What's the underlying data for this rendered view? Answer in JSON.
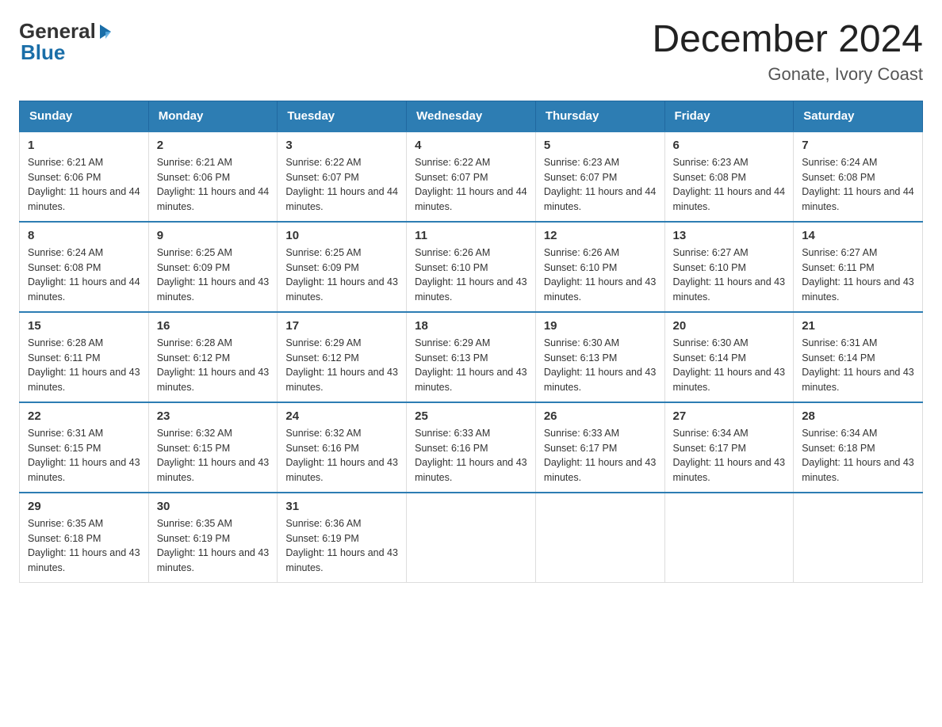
{
  "header": {
    "logo_general": "General",
    "logo_blue": "Blue",
    "main_title": "December 2024",
    "subtitle": "Gonate, Ivory Coast"
  },
  "calendar": {
    "days_of_week": [
      "Sunday",
      "Monday",
      "Tuesday",
      "Wednesday",
      "Thursday",
      "Friday",
      "Saturday"
    ],
    "weeks": [
      [
        {
          "day": 1,
          "sunrise": "6:21 AM",
          "sunset": "6:06 PM",
          "daylight": "11 hours and 44 minutes."
        },
        {
          "day": 2,
          "sunrise": "6:21 AM",
          "sunset": "6:06 PM",
          "daylight": "11 hours and 44 minutes."
        },
        {
          "day": 3,
          "sunrise": "6:22 AM",
          "sunset": "6:07 PM",
          "daylight": "11 hours and 44 minutes."
        },
        {
          "day": 4,
          "sunrise": "6:22 AM",
          "sunset": "6:07 PM",
          "daylight": "11 hours and 44 minutes."
        },
        {
          "day": 5,
          "sunrise": "6:23 AM",
          "sunset": "6:07 PM",
          "daylight": "11 hours and 44 minutes."
        },
        {
          "day": 6,
          "sunrise": "6:23 AM",
          "sunset": "6:08 PM",
          "daylight": "11 hours and 44 minutes."
        },
        {
          "day": 7,
          "sunrise": "6:24 AM",
          "sunset": "6:08 PM",
          "daylight": "11 hours and 44 minutes."
        }
      ],
      [
        {
          "day": 8,
          "sunrise": "6:24 AM",
          "sunset": "6:08 PM",
          "daylight": "11 hours and 44 minutes."
        },
        {
          "day": 9,
          "sunrise": "6:25 AM",
          "sunset": "6:09 PM",
          "daylight": "11 hours and 43 minutes."
        },
        {
          "day": 10,
          "sunrise": "6:25 AM",
          "sunset": "6:09 PM",
          "daylight": "11 hours and 43 minutes."
        },
        {
          "day": 11,
          "sunrise": "6:26 AM",
          "sunset": "6:10 PM",
          "daylight": "11 hours and 43 minutes."
        },
        {
          "day": 12,
          "sunrise": "6:26 AM",
          "sunset": "6:10 PM",
          "daylight": "11 hours and 43 minutes."
        },
        {
          "day": 13,
          "sunrise": "6:27 AM",
          "sunset": "6:10 PM",
          "daylight": "11 hours and 43 minutes."
        },
        {
          "day": 14,
          "sunrise": "6:27 AM",
          "sunset": "6:11 PM",
          "daylight": "11 hours and 43 minutes."
        }
      ],
      [
        {
          "day": 15,
          "sunrise": "6:28 AM",
          "sunset": "6:11 PM",
          "daylight": "11 hours and 43 minutes."
        },
        {
          "day": 16,
          "sunrise": "6:28 AM",
          "sunset": "6:12 PM",
          "daylight": "11 hours and 43 minutes."
        },
        {
          "day": 17,
          "sunrise": "6:29 AM",
          "sunset": "6:12 PM",
          "daylight": "11 hours and 43 minutes."
        },
        {
          "day": 18,
          "sunrise": "6:29 AM",
          "sunset": "6:13 PM",
          "daylight": "11 hours and 43 minutes."
        },
        {
          "day": 19,
          "sunrise": "6:30 AM",
          "sunset": "6:13 PM",
          "daylight": "11 hours and 43 minutes."
        },
        {
          "day": 20,
          "sunrise": "6:30 AM",
          "sunset": "6:14 PM",
          "daylight": "11 hours and 43 minutes."
        },
        {
          "day": 21,
          "sunrise": "6:31 AM",
          "sunset": "6:14 PM",
          "daylight": "11 hours and 43 minutes."
        }
      ],
      [
        {
          "day": 22,
          "sunrise": "6:31 AM",
          "sunset": "6:15 PM",
          "daylight": "11 hours and 43 minutes."
        },
        {
          "day": 23,
          "sunrise": "6:32 AM",
          "sunset": "6:15 PM",
          "daylight": "11 hours and 43 minutes."
        },
        {
          "day": 24,
          "sunrise": "6:32 AM",
          "sunset": "6:16 PM",
          "daylight": "11 hours and 43 minutes."
        },
        {
          "day": 25,
          "sunrise": "6:33 AM",
          "sunset": "6:16 PM",
          "daylight": "11 hours and 43 minutes."
        },
        {
          "day": 26,
          "sunrise": "6:33 AM",
          "sunset": "6:17 PM",
          "daylight": "11 hours and 43 minutes."
        },
        {
          "day": 27,
          "sunrise": "6:34 AM",
          "sunset": "6:17 PM",
          "daylight": "11 hours and 43 minutes."
        },
        {
          "day": 28,
          "sunrise": "6:34 AM",
          "sunset": "6:18 PM",
          "daylight": "11 hours and 43 minutes."
        }
      ],
      [
        {
          "day": 29,
          "sunrise": "6:35 AM",
          "sunset": "6:18 PM",
          "daylight": "11 hours and 43 minutes."
        },
        {
          "day": 30,
          "sunrise": "6:35 AM",
          "sunset": "6:19 PM",
          "daylight": "11 hours and 43 minutes."
        },
        {
          "day": 31,
          "sunrise": "6:36 AM",
          "sunset": "6:19 PM",
          "daylight": "11 hours and 43 minutes."
        },
        null,
        null,
        null,
        null
      ]
    ]
  }
}
